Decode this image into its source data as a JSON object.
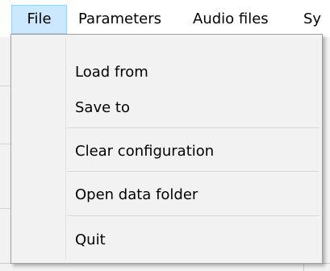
{
  "menubar": {
    "items": [
      {
        "label": "File"
      },
      {
        "label": "Parameters"
      },
      {
        "label": "Audio files"
      },
      {
        "label": "Sy"
      }
    ]
  },
  "file_menu": {
    "items": [
      {
        "label": "Load from"
      },
      {
        "label": "Save to"
      },
      {
        "label": "Clear configuration"
      },
      {
        "label": "Open data folder"
      },
      {
        "label": "Quit"
      }
    ]
  },
  "colors": {
    "menubar_background": "#ffffff",
    "open_menu_highlight": "#cce8ff",
    "open_menu_border": "#99d1ff",
    "dropdown_background": "#f2f2f2",
    "dropdown_border": "#a0a0a0"
  }
}
